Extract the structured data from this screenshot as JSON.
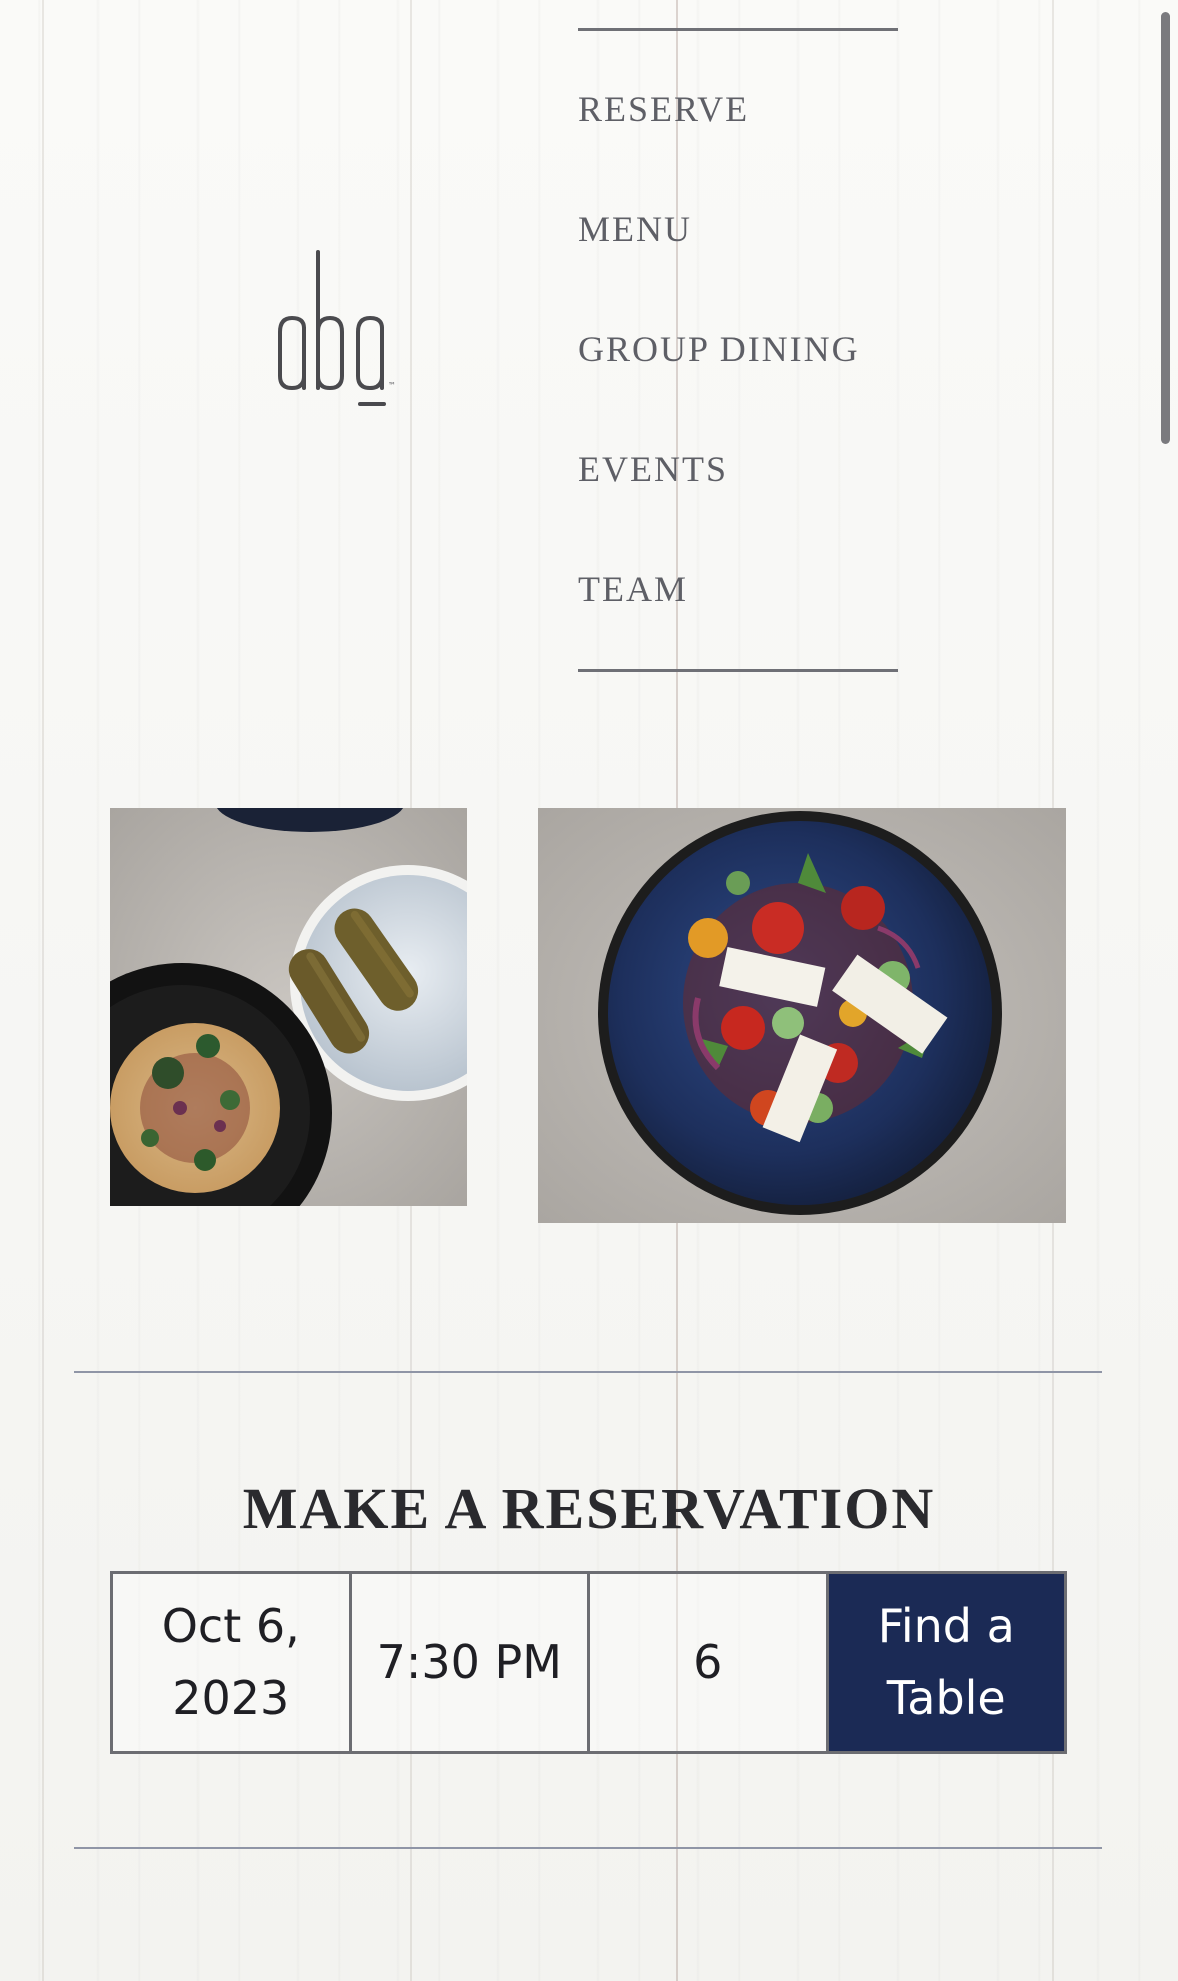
{
  "brand": {
    "logo_text": "aba",
    "trademark": "™"
  },
  "nav": {
    "items": [
      {
        "label": "RESERVE"
      },
      {
        "label": "MENU"
      },
      {
        "label": "GROUP DINING"
      },
      {
        "label": "EVENTS"
      },
      {
        "label": "TEAM"
      }
    ]
  },
  "gallery": {
    "images": [
      {
        "subject": "hummus bowl and stuffed grape leaves on ice"
      },
      {
        "subject": "greek salad with feta in blue bowl"
      }
    ]
  },
  "reservation": {
    "title": "MAKE A RESERVATION",
    "date": "Oct 6, 2023",
    "time": "7:30 PM",
    "party_size": "6",
    "submit_label": "Find a Table"
  },
  "colors": {
    "accent": "#1b2a55",
    "nav_text": "#5e5f66",
    "rule": "#8f95a6"
  }
}
